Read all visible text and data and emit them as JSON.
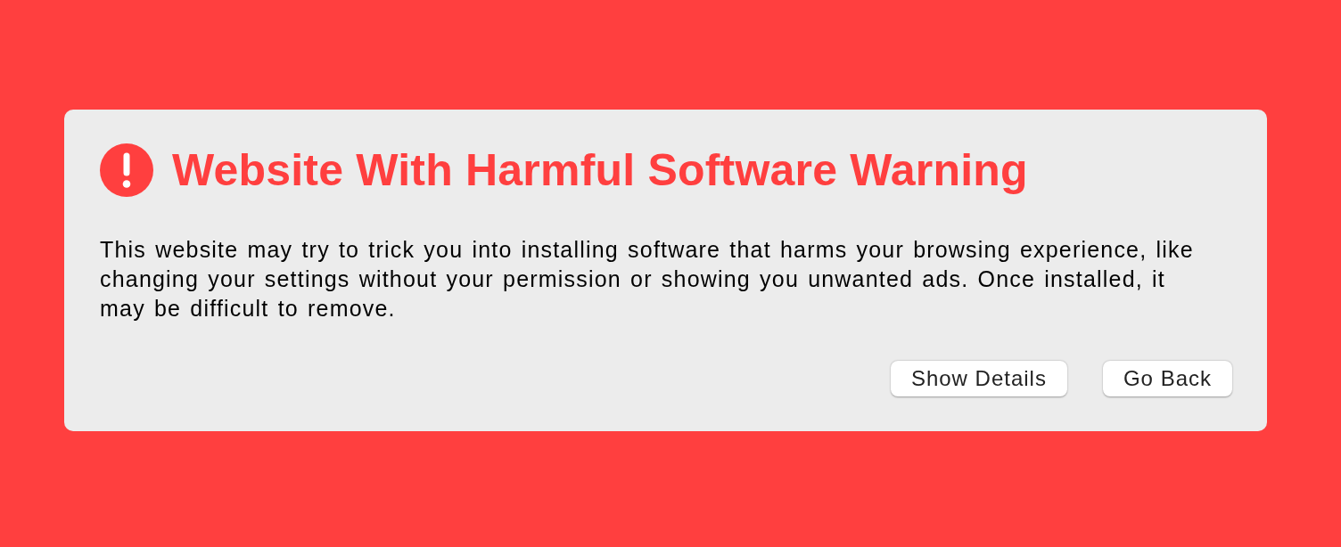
{
  "warning": {
    "title": "Website With Harmful Software Warning",
    "message": "This website may try to trick you into installing software that harms your browsing experience, like changing your settings without your permission or showing you unwanted ads. Once installed, it may be difficult to remove.",
    "buttons": [
      {
        "label": "Show Details"
      },
      {
        "label": "Go Back"
      }
    ]
  }
}
